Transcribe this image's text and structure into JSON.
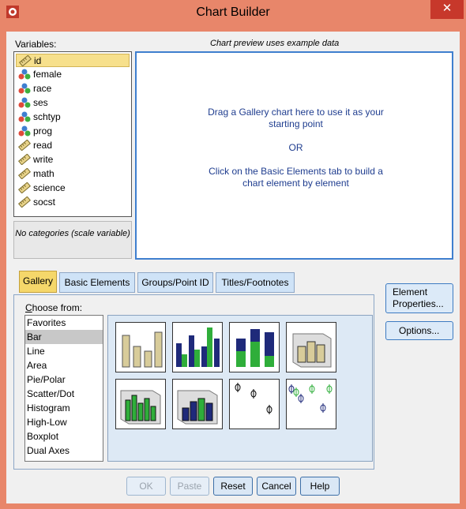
{
  "window": {
    "title": "Chart Builder",
    "close_glyph": "✕"
  },
  "variables": {
    "label": "Variables:",
    "items": [
      {
        "name": "id",
        "kind": "scale"
      },
      {
        "name": "female",
        "kind": "nominal"
      },
      {
        "name": "race",
        "kind": "nominal"
      },
      {
        "name": "ses",
        "kind": "nominal"
      },
      {
        "name": "schtyp",
        "kind": "nominal"
      },
      {
        "name": "prog",
        "kind": "nominal"
      },
      {
        "name": "read",
        "kind": "scale"
      },
      {
        "name": "write",
        "kind": "scale"
      },
      {
        "name": "math",
        "kind": "scale"
      },
      {
        "name": "science",
        "kind": "scale"
      },
      {
        "name": "socst",
        "kind": "scale"
      }
    ],
    "categories_note": "No categories (scale variable)"
  },
  "preview": {
    "label": "Chart preview uses example data",
    "line1": "Drag a Gallery chart here to use it as your",
    "line2": "starting point",
    "or": "OR",
    "line3": "Click on the Basic Elements tab to build a",
    "line4": "chart element by element"
  },
  "tabs": [
    "Gallery",
    "Basic Elements",
    "Groups/Point ID",
    "Titles/Footnotes"
  ],
  "gallery": {
    "choose_label": "Choose from:",
    "items": [
      "Favorites",
      "Bar",
      "Line",
      "Area",
      "Pie/Polar",
      "Scatter/Dot",
      "Histogram",
      "High-Low",
      "Boxplot",
      "Dual Axes"
    ],
    "selected": "Bar"
  },
  "side_buttons": {
    "element_properties_1": "Element",
    "element_properties_2": "Properties...",
    "options": "Options..."
  },
  "buttons": {
    "ok": "OK",
    "paste": "Paste",
    "reset": "Reset",
    "cancel": "Cancel",
    "help": "Help"
  },
  "colors": {
    "accent": "#f5d76a",
    "tab_inactive": "#cfe3f7",
    "preview_border": "#3f7fcf",
    "bar_tan": "#d8cc9a",
    "bar_navy": "#1f2a7a",
    "bar_green": "#2fae3a"
  }
}
